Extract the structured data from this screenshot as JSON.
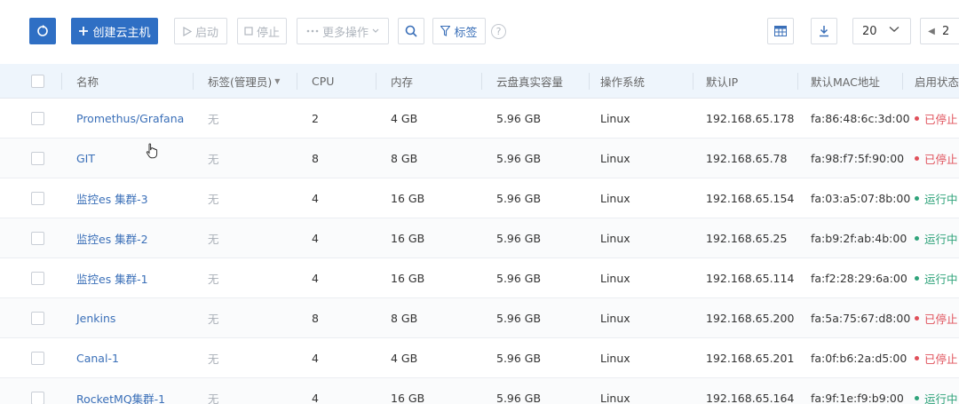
{
  "toolbar": {
    "create_label": "创建云主机",
    "start_label": "启动",
    "stop_label": "停止",
    "more_label": "更多操作",
    "tags_label": "标签",
    "help_glyph": "?",
    "page_size": "20",
    "page_current": "2"
  },
  "table": {
    "headers": {
      "name": "名称",
      "tag": "标签(管理员)",
      "cpu": "CPU",
      "memory": "内存",
      "disk": "云盘真实容量",
      "os": "操作系统",
      "ip": "默认IP",
      "mac": "默认MAC地址",
      "status": "启用状态"
    },
    "rows": [
      {
        "name": "Promethus/Grafana",
        "tag": "无",
        "cpu": "2",
        "memory": "4 GB",
        "disk": "5.96 GB",
        "os": "Linux",
        "ip": "192.168.65.178",
        "mac": "fa:86:48:6c:3d:00",
        "status": "已停止",
        "state": "stopped"
      },
      {
        "name": "GIT",
        "tag": "无",
        "cpu": "8",
        "memory": "8 GB",
        "disk": "5.96 GB",
        "os": "Linux",
        "ip": "192.168.65.78",
        "mac": "fa:98:f7:5f:90:00",
        "status": "已停止",
        "state": "stopped"
      },
      {
        "name": "监控es 集群-3",
        "tag": "无",
        "cpu": "4",
        "memory": "16 GB",
        "disk": "5.96 GB",
        "os": "Linux",
        "ip": "192.168.65.154",
        "mac": "fa:03:a5:07:8b:00",
        "status": "运行中",
        "state": "running"
      },
      {
        "name": "监控es 集群-2",
        "tag": "无",
        "cpu": "4",
        "memory": "16 GB",
        "disk": "5.96 GB",
        "os": "Linux",
        "ip": "192.168.65.25",
        "mac": "fa:b9:2f:ab:4b:00",
        "status": "运行中",
        "state": "running"
      },
      {
        "name": "监控es 集群-1",
        "tag": "无",
        "cpu": "4",
        "memory": "16 GB",
        "disk": "5.96 GB",
        "os": "Linux",
        "ip": "192.168.65.114",
        "mac": "fa:f2:28:29:6a:00",
        "status": "运行中",
        "state": "running"
      },
      {
        "name": "Jenkins",
        "tag": "无",
        "cpu": "8",
        "memory": "8 GB",
        "disk": "5.96 GB",
        "os": "Linux",
        "ip": "192.168.65.200",
        "mac": "fa:5a:75:67:d8:00",
        "status": "已停止",
        "state": "stopped"
      },
      {
        "name": "Canal-1",
        "tag": "无",
        "cpu": "4",
        "memory": "4 GB",
        "disk": "5.96 GB",
        "os": "Linux",
        "ip": "192.168.65.201",
        "mac": "fa:0f:b6:2a:d5:00",
        "status": "已停止",
        "state": "stopped"
      },
      {
        "name": "RocketMQ集群-1",
        "tag": "无",
        "cpu": "4",
        "memory": "16 GB",
        "disk": "5.96 GB",
        "os": "Linux",
        "ip": "192.168.65.164",
        "mac": "fa:9f:1e:f9:b9:00",
        "status": "运行中",
        "state": "running"
      }
    ]
  },
  "colors": {
    "primary": "#2f6fc4",
    "link": "#3a6fb8",
    "stopped": "#e0505a",
    "running": "#2fa37a",
    "header_bg": "#eef5fc"
  },
  "icons": [
    "refresh-icon",
    "plus-icon",
    "play-icon",
    "stop-icon",
    "dots-icon",
    "chevron-down-icon",
    "search-icon",
    "filter-icon",
    "help-icon",
    "table-settings-icon",
    "download-icon",
    "chevron-left-icon",
    "pointer-cursor-icon"
  ]
}
